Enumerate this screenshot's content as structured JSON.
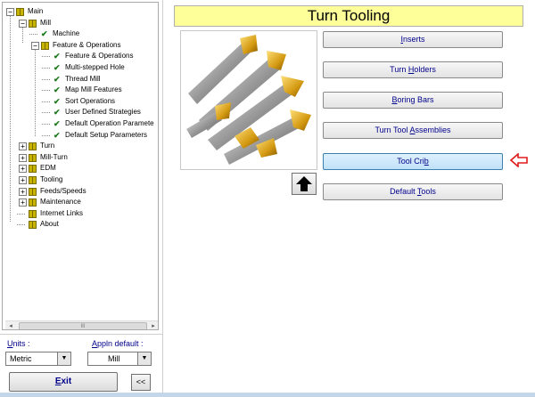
{
  "tree": {
    "nodes": [
      {
        "id": "main",
        "label": "Main",
        "level": 0,
        "expander": "−",
        "icon": "book"
      },
      {
        "id": "mill",
        "label": "Mill",
        "level": 1,
        "expander": "−",
        "icon": "book"
      },
      {
        "id": "machine",
        "label": "Machine",
        "level": 2,
        "icon": "check"
      },
      {
        "id": "feature-operations",
        "label": "Feature & Operations",
        "level": 2,
        "expander": "−",
        "icon": "book"
      },
      {
        "id": "feature-operations-sub",
        "label": "Feature & Operations",
        "level": 3,
        "icon": "check"
      },
      {
        "id": "multi-stepped-hole",
        "label": "Multi-stepped Hole",
        "level": 3,
        "icon": "check"
      },
      {
        "id": "thread-mill",
        "label": "Thread Mill",
        "level": 3,
        "icon": "check"
      },
      {
        "id": "map-mill-features",
        "label": "Map Mill Features",
        "level": 3,
        "icon": "check"
      },
      {
        "id": "sort-operations",
        "label": "Sort Operations",
        "level": 3,
        "icon": "check"
      },
      {
        "id": "user-defined-strategies",
        "label": "User Defined Strategies",
        "level": 3,
        "icon": "check"
      },
      {
        "id": "default-operation-parameters",
        "label": "Default Operation Paramete",
        "level": 3,
        "icon": "check"
      },
      {
        "id": "default-setup-parameters",
        "label": "Default Setup Parameters",
        "level": 3,
        "icon": "check"
      },
      {
        "id": "turn",
        "label": "Turn",
        "level": 1,
        "expander": "+",
        "icon": "book"
      },
      {
        "id": "mill-turn",
        "label": "Mill-Turn",
        "level": 1,
        "expander": "+",
        "icon": "book"
      },
      {
        "id": "edm",
        "label": "EDM",
        "level": 1,
        "expander": "+",
        "icon": "book"
      },
      {
        "id": "tooling",
        "label": "Tooling",
        "level": 1,
        "expander": "+",
        "icon": "book"
      },
      {
        "id": "feeds-speeds",
        "label": "Feeds/Speeds",
        "level": 1,
        "expander": "+",
        "icon": "book"
      },
      {
        "id": "maintenance",
        "label": "Maintenance",
        "level": 1,
        "expander": "+",
        "icon": "book"
      },
      {
        "id": "internet-links",
        "label": "Internet Links",
        "level": 1,
        "icon": "book"
      },
      {
        "id": "about",
        "label": "About",
        "level": 1,
        "icon": "book"
      }
    ],
    "scroll_thumb_glyph": "III",
    "scroll_left_glyph": "◂",
    "scroll_right_glyph": "▸"
  },
  "units": {
    "label_underlined": "U",
    "label_rest": "nits :",
    "value": "Metric"
  },
  "appln_default": {
    "label_underlined": "A",
    "label_rest": "ppln default :",
    "value": "Mill"
  },
  "combo_drop_glyph": "▼",
  "exit_button": {
    "label_underlined": "E",
    "label_rest": "xit"
  },
  "collapse_button": {
    "label": "<<"
  },
  "title": "Turn Tooling",
  "image_alt_icon": "turn-tools-photo",
  "buttons": [
    {
      "id": "inserts",
      "pre": "",
      "u": "I",
      "post": "nserts",
      "selected": false
    },
    {
      "id": "turn-holders",
      "pre": "Turn ",
      "u": "H",
      "post": "olders",
      "selected": false
    },
    {
      "id": "boring-bars",
      "pre": "",
      "u": "B",
      "post": "oring Bars",
      "selected": false
    },
    {
      "id": "turn-tool-assemblies",
      "pre": "Turn Tool ",
      "u": "A",
      "post": "ssemblies",
      "selected": false
    },
    {
      "id": "tool-crib",
      "pre": "Tool Cri",
      "u": "b",
      "post": "",
      "selected": true
    },
    {
      "id": "default-tools",
      "pre": "Default ",
      "u": "T",
      "post": "ools",
      "selected": false
    }
  ],
  "colors": {
    "accent_arrow": "#e01b1b",
    "title_bg": "#ffff99",
    "link_text": "#00008b"
  }
}
